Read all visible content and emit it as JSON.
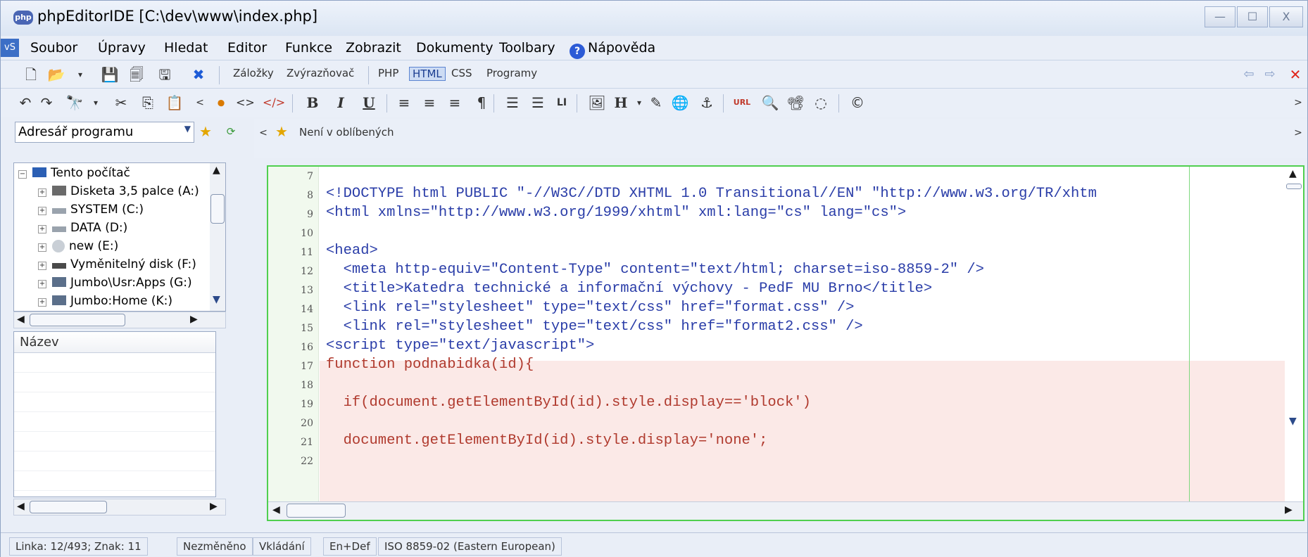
{
  "window": {
    "title": "phpEditorIDE [C:\\dev\\www\\index.php]",
    "logo": "php",
    "minimize": "—",
    "maximize": "☐",
    "close": "X"
  },
  "menu": {
    "logo": "vS",
    "items": [
      "Soubor",
      "Úpravy",
      "Hledat",
      "Editor",
      "Funkce",
      "Zobrazit",
      "Dokumenty",
      "Toolbary",
      "Nápověda"
    ]
  },
  "toolbar1": {
    "tabs": [
      "Záložky",
      "Zvýrazňovač",
      "PHP",
      "HTML",
      "CSS",
      "Programy"
    ],
    "close": "✕"
  },
  "toolbar2": {
    "bold": "B",
    "italic": "I",
    "underline": "U",
    "li": "LI",
    "url": "URL",
    "h": "H"
  },
  "sidebar": {
    "dir_select": "Adresář programu",
    "tree": [
      "Tento počítač",
      "Disketa 3,5 palce (A:)",
      "SYSTEM (C:)",
      "DATA (D:)",
      "new (E:)",
      "Vyměnitelný disk (F:)",
      "Jumbo\\Usr:Apps (G:)",
      "Jumbo:Home (K:)"
    ],
    "list_header": "Název"
  },
  "favorites": {
    "text": "Není v oblíbených"
  },
  "editor": {
    "line_numbers": [
      "7",
      "8",
      "9",
      "10",
      "11",
      "12",
      "13",
      "14",
      "15",
      "16",
      "17",
      "18",
      "19",
      "20",
      "21",
      "22"
    ],
    "lines": [
      "",
      "<!DOCTYPE html PUBLIC \"-//W3C//DTD XHTML 1.0 Transitional//EN\" \"http://www.w3.org/TR/xhtm",
      "<html xmlns=\"http://www.w3.org/1999/xhtml\" xml:lang=\"cs\" lang=\"cs\">",
      "",
      "<head>",
      "  <meta http-equiv=\"Content-Type\" content=\"text/html; charset=iso-8859-2\" />",
      "  <title>Katedra technické a informační výchovy - PedF MU Brno</title>",
      "  <link rel=\"stylesheet\" type=\"text/css\" href=\"format.css\" />",
      "  <link rel=\"stylesheet\" type=\"text/css\" href=\"format2.css\" />",
      "<script type=\"text/javascript\">",
      "function podnabidka(id){",
      "",
      "  if(document.getElementById(id).style.display=='block')",
      "",
      "  document.getElementById(id).style.display='none';",
      ""
    ]
  },
  "status": {
    "position": "Linka: 12/493; Znak: 11",
    "modified": "Nezměněno",
    "mode": "Vkládání",
    "encoding_mode": "En+Def",
    "charset": "ISO 8859-02 (Eastern European)"
  }
}
